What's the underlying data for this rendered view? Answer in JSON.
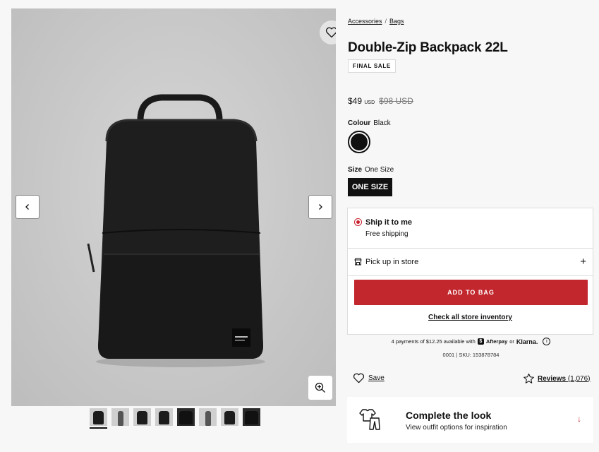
{
  "breadcrumb": {
    "items": [
      "Accessories",
      "Bags"
    ],
    "separator": "/"
  },
  "product": {
    "title": "Double-Zip Backpack 22L",
    "badge": "FINAL SALE",
    "price": "$49",
    "price_currency": "USD",
    "original_price": "$98 USD"
  },
  "colour": {
    "label": "Colour",
    "value": "Black",
    "swatch_color": "#111111"
  },
  "size": {
    "label": "Size",
    "value": "One Size",
    "button_label": "ONE SIZE"
  },
  "shipping": {
    "ship_title": "Ship it to me",
    "ship_sub": "Free shipping",
    "pickup_label": "Pick up in store",
    "add_to_bag": "ADD TO BAG",
    "inventory_link": "Check all store inventory"
  },
  "payments": {
    "prefix": "4 payments of $12.25 available with",
    "afterpay": "Afterpay",
    "or": "or",
    "klarna": "Klarna."
  },
  "sku_line": "0001 | SKU: 153878784",
  "actions": {
    "save": "Save",
    "reviews_label": "Reviews",
    "reviews_count": "(1,076)"
  },
  "complete_look": {
    "title": "Complete the look",
    "subtitle": "View outfit options for inspiration"
  },
  "colors": {
    "accent_red": "#c1272d",
    "radio_red": "#c8202f"
  },
  "icons": [
    "heart-icon",
    "chevron-left-icon",
    "chevron-right-icon",
    "zoom-in-icon",
    "store-icon",
    "plus-icon",
    "star-icon",
    "outfit-icon",
    "arrow-down-icon",
    "info-icon"
  ]
}
